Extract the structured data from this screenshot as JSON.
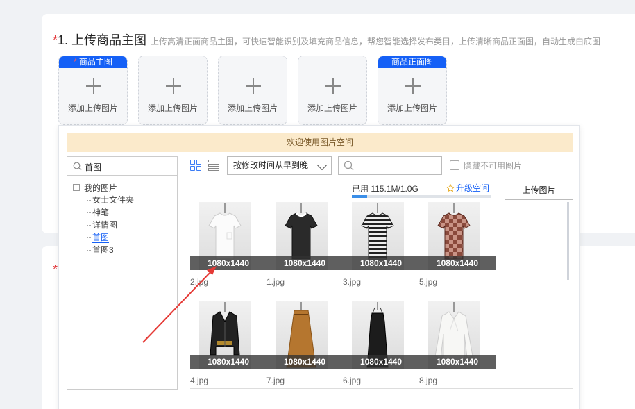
{
  "section": {
    "required_mark": "*",
    "title": "1. 上传商品主图",
    "hint": "上传高清正面商品主图，可快速智能识别及填充商品信息，帮您智能选择发布类目，上传清晰商品正面图，自动生成白底图"
  },
  "slots": [
    {
      "tag": "商品主图",
      "required": true,
      "label": "添加上传图片"
    },
    {
      "tag": "",
      "required": false,
      "label": "添加上传图片"
    },
    {
      "tag": "",
      "required": false,
      "label": "添加上传图片"
    },
    {
      "tag": "",
      "required": false,
      "label": "添加上传图片"
    },
    {
      "tag": "商品正面图",
      "required": false,
      "label": "添加上传图片"
    }
  ],
  "picker": {
    "welcome": "欢迎使用图片空间",
    "folder_search": "首图",
    "tree": {
      "root": "我的图片",
      "children": [
        "女士文件夹",
        "神笔",
        "详情图",
        "首图",
        "首图3"
      ],
      "active_index": 3
    },
    "sort": "按修改时间从早到晚",
    "search_placeholder": "",
    "hide_unavailable": "隐藏不可用图片",
    "usage": {
      "label": "已用 115.1M/1.0G",
      "fraction": 0.11
    },
    "upgrade": "升级空间",
    "upload_button": "上传图片",
    "images": [
      {
        "name": "2.jpg",
        "dims": "1080x1440",
        "item": "white-tshirt"
      },
      {
        "name": "1.jpg",
        "dims": "1080x1440",
        "item": "black-tshirt"
      },
      {
        "name": "3.jpg",
        "dims": "1080x1440",
        "item": "striped-tshirt"
      },
      {
        "name": "5.jpg",
        "dims": "1080x1440",
        "item": "checkered-tshirt"
      },
      {
        "name": "4.jpg",
        "dims": "1080x1440",
        "item": "leather-jacket"
      },
      {
        "name": "7.jpg",
        "dims": "1080x1440",
        "item": "brown-skirt"
      },
      {
        "name": "6.jpg",
        "dims": "1080x1440",
        "item": "black-slip-dress"
      },
      {
        "name": "8.jpg",
        "dims": "1080x1440",
        "item": "white-blouse"
      }
    ]
  },
  "colors": {
    "accent": "#1560f6",
    "required": "#e4393c",
    "annotation_arrow": "#e53935"
  }
}
